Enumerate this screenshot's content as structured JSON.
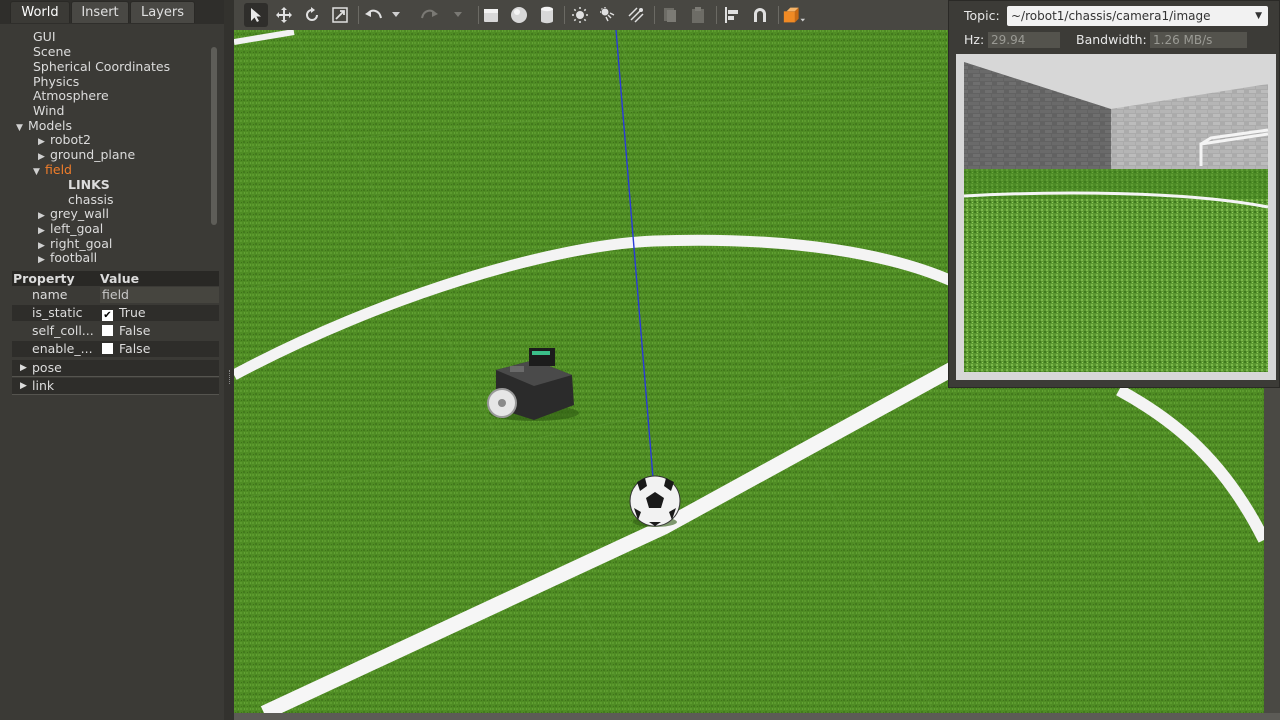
{
  "tabs": [
    {
      "label": "World",
      "active": true
    },
    {
      "label": "Insert",
      "active": false
    },
    {
      "label": "Layers",
      "active": false
    }
  ],
  "tree": {
    "items": {
      "gui": "GUI",
      "scene": "Scene",
      "spherical": "Spherical Coordinates",
      "physics": "Physics",
      "atmosphere": "Atmosphere",
      "wind": "Wind",
      "models": "Models",
      "robot2": "robot2",
      "ground_plane": "ground_plane",
      "field": "field",
      "links": "LINKS",
      "chassis": "chassis",
      "grey_wall": "grey_wall",
      "left_goal": "left_goal",
      "right_goal": "right_goal",
      "football": "football"
    }
  },
  "properties": {
    "header_property": "Property",
    "header_value": "Value",
    "name_label": "name",
    "name_value": "field",
    "is_static_label": "is_static",
    "is_static_value": "True",
    "self_collide_label": "self_coll...",
    "self_collide_value": "False",
    "enable_wind_label": "enable_...",
    "enable_wind_value": "False",
    "pose_label": "pose",
    "link_label": "link"
  },
  "toolbar": {
    "icons": [
      "select-arrow-icon",
      "translate-icon",
      "rotate-icon",
      "scale-icon",
      "undo-icon",
      "undo-dropdown-icon",
      "redo-icon",
      "redo-dropdown-icon",
      "box-shape-icon",
      "sphere-shape-icon",
      "cylinder-shape-icon",
      "point-light-icon",
      "spot-light-icon",
      "directional-light-icon",
      "copy-icon",
      "paste-icon",
      "align-icon",
      "snap-icon",
      "view-angle-icon"
    ]
  },
  "camera": {
    "topic_label": "Topic:",
    "topic_value": "~/robot1/chassis/camera1/image",
    "hz_label": "Hz:",
    "hz_value": "29.94",
    "bandwidth_label": "Bandwidth:",
    "bandwidth_value": "1.26 MB/s"
  },
  "colors": {
    "grass": "#4d8b23",
    "selection": "#f07d2a",
    "panel": "#3b3a36",
    "active_tool": "#f08a24"
  }
}
